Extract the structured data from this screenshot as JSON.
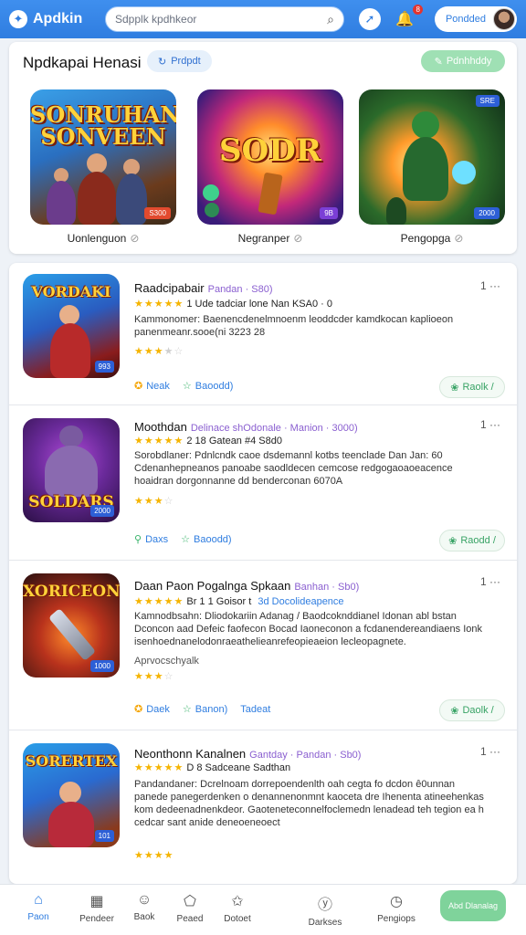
{
  "header": {
    "app_name": "Apdkin",
    "search_placeholder": "Sdpplk kpdhkeor",
    "bell_badge": "8",
    "account_label": "Pondded"
  },
  "featured": {
    "title": "Npdkapai Henasi",
    "chip_label": "Prdpdt",
    "action_label": "Pdnhhddy",
    "tiles": [
      {
        "art_title": "SONRUHAN SONVEEN",
        "tag": "S300",
        "caption": "Uonlenguon"
      },
      {
        "art_title": "SODR",
        "tag": "9B",
        "caption": "Negranper"
      },
      {
        "art_title": "",
        "tag": "2000",
        "tag_top": "SRE",
        "caption": "Pengopga"
      }
    ]
  },
  "list": [
    {
      "art_title": "VORDAKI",
      "tag": "993",
      "title": "Raadcipabair",
      "subtitle": "Pandan · S80)",
      "rating_text": "1 Ude tadciar lone Nan KSA0 · 0",
      "desc": "Kammonomer:   Baenencdenelmnoenm leoddcder kamdkocan kaplioeon panenmeanr.sooe(ni 3223 28",
      "small": "",
      "stars2": 3.5,
      "actions": [
        "Neak",
        "Baoodd)"
      ],
      "button": "Raolk /"
    },
    {
      "art_title": "SOLDARS",
      "tag": "2000",
      "title": "Moothdan",
      "subtitle": "Delinace shOdonale · Manion · 3000)",
      "rating_text": "2 18  Gatean #4 S8d0",
      "desc": "Sorobdlaner:   Pdnlcndk caoe dsdemannl kotbs teenclade Dan Jan: 60 Cdenanhepneanos panoabe saodldecen cemcose redgogaoaoeacence hoaidran dorgonnanne dd benderconan 6070A",
      "small": "",
      "stars2": 3,
      "actions": [
        "Daxs",
        "Baoodd)"
      ],
      "button": "Raodd /"
    },
    {
      "art_title": "XORICEON",
      "tag": "1000",
      "title": "Daan Paon Pogalnga Spkaan",
      "subtitle": "Banhan · Sb0)",
      "rating_text": "Br 1 1 Goisor t  ",
      "rating_extra": "3d Docolideapence",
      "desc": "Kamnodbsahn:   Dliodokariin Adanag  / Baodcoknddianel Idonan abl bstan Dconcon aad Defeic faofecon  Bocad Iaoneconon  a fcdanendereandiaens Ionk isenhoednanelodonraeathelieanrefeopieaeion  lecleopagnete.",
      "small": "Aprvocschyalk",
      "stars2": 3.5,
      "actions": [
        "Daek",
        "Banon)",
        "Tadeat"
      ],
      "button": "Daolk /"
    },
    {
      "art_title": "SORERTEX",
      "tag": "101",
      "title": "Neonthonn Kanalnen",
      "subtitle": "Gantday · Pandan · Sb0)",
      "rating_text": "D 8 Sadceane Sadthan",
      "desc": "Pandandaner:   Dcrelnoam dorrepoendenlth oah cegta fo dcdon ê0unnan panede panegerdenken o denannenonmnt kaoceta dre Ihenenta atineehenkas kom dedeenadnenkdeor. Gaoteneteconnelfoclemedn lenadead teh tegion ea h cedcar sant anide deneoeneoect",
      "small": "",
      "stars2": 4,
      "actions": [],
      "button": ""
    }
  ],
  "bottomnav": {
    "items": [
      {
        "label": "Paon",
        "icon": "home-icon"
      },
      {
        "label": "Pendeer",
        "icon": "grid-icon"
      },
      {
        "label": "Baok",
        "icon": "chat-icon"
      },
      {
        "label": "Peaed",
        "icon": "puzzle-icon"
      },
      {
        "label": "Dotoet",
        "icon": "star-icon"
      },
      {
        "label": "Darkses",
        "icon": "check-icon"
      },
      {
        "label": "Pengiops",
        "icon": "clock-icon"
      }
    ],
    "cta_label": "Abd Dlanalag"
  }
}
